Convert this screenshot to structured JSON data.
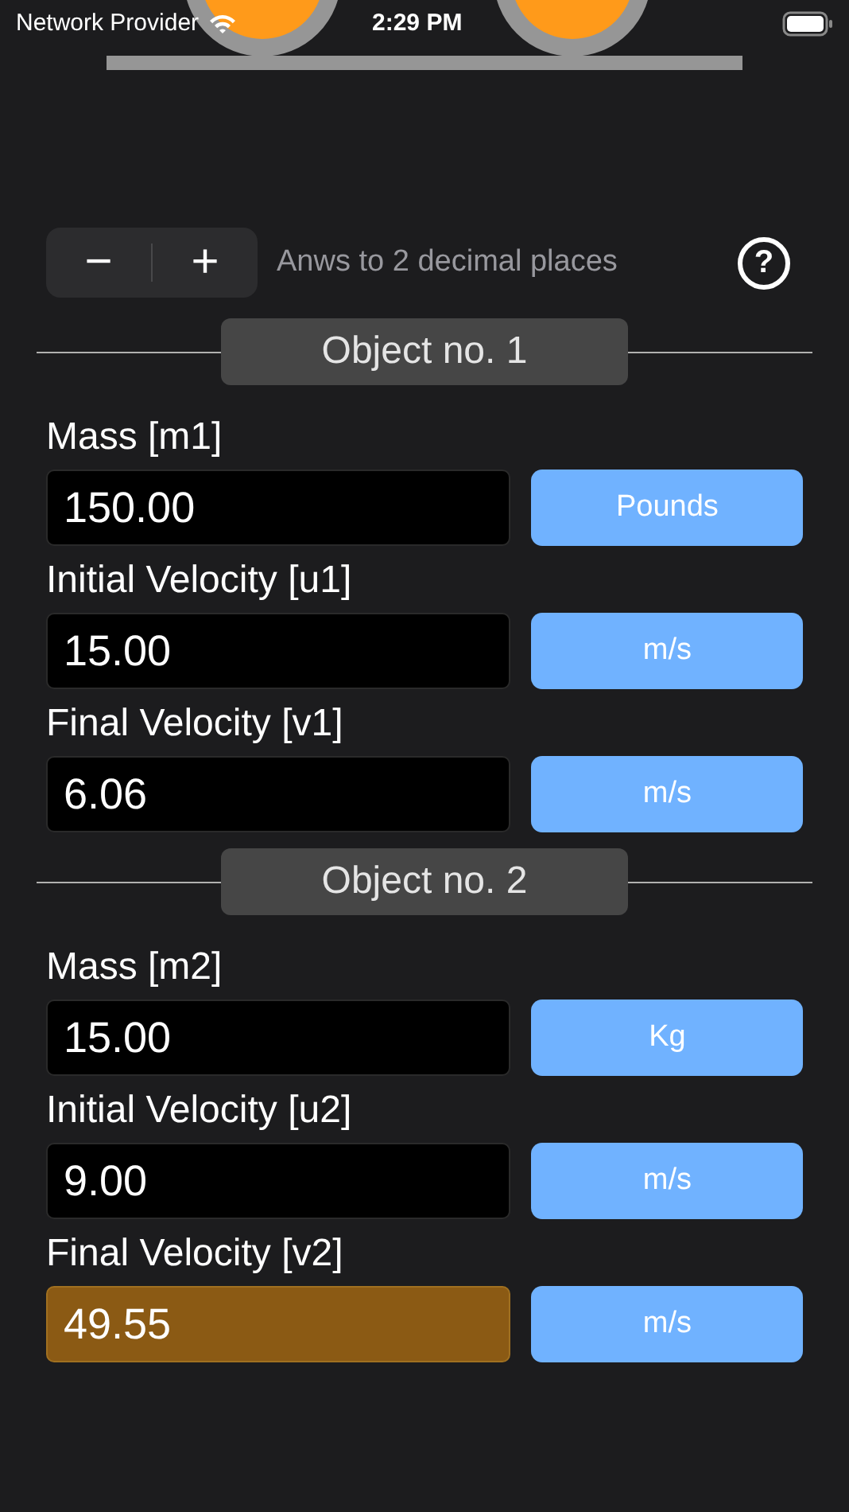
{
  "status_bar": {
    "carrier": "Network Provider",
    "time": "2:29 PM"
  },
  "toolbar": {
    "decrement": "−",
    "increment": "+",
    "precision_note": "Anws to 2 decimal places",
    "help": "?"
  },
  "objects": [
    {
      "title": "Object no. 1",
      "fields": [
        {
          "label": "Mass [m1]",
          "value": "150.00",
          "unit": "Pounds",
          "highlighted": false
        },
        {
          "label": "Initial Velocity [u1]",
          "value": "15.00",
          "unit": "m/s",
          "highlighted": false
        },
        {
          "label": "Final Velocity [v1]",
          "value": "6.06",
          "unit": "m/s",
          "highlighted": false
        }
      ]
    },
    {
      "title": "Object no. 2",
      "fields": [
        {
          "label": "Mass [m2]",
          "value": "15.00",
          "unit": "Kg",
          "highlighted": false
        },
        {
          "label": "Initial Velocity [u2]",
          "value": "9.00",
          "unit": "m/s",
          "highlighted": false
        },
        {
          "label": "Final Velocity [v2]",
          "value": "49.55",
          "unit": "m/s",
          "highlighted": true
        }
      ]
    }
  ]
}
